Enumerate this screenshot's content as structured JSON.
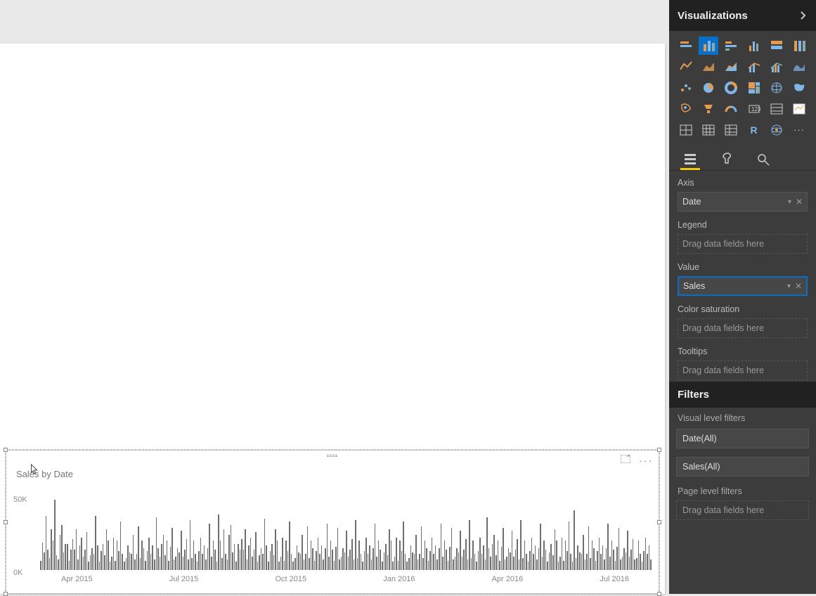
{
  "visualizations_pane": {
    "title": "Visualizations",
    "tabs": [
      "Fields",
      "Format",
      "Analytics"
    ],
    "icons": [
      "stacked-bar",
      "stacked-column",
      "clustered-bar",
      "clustered-column",
      "100-stacked-bar",
      "100-stacked-column",
      "line",
      "area",
      "stacked-area",
      "line-stacked-column",
      "line-clustered-column",
      "ribbon",
      "waterfall",
      "pie",
      "donut",
      "treemap",
      "map",
      "filled-map",
      "funnel",
      "gauge",
      "card",
      "multi-row-card",
      "kpi",
      "slicer",
      "matrix",
      "table",
      "table2",
      "r-script",
      "arcgis",
      "more"
    ],
    "selected_icon_index": 1,
    "wells": {
      "axis": {
        "label": "Axis",
        "value": "Date"
      },
      "legend": {
        "label": "Legend",
        "placeholder": "Drag data fields here"
      },
      "value": {
        "label": "Value",
        "value": "Sales"
      },
      "color_saturation": {
        "label": "Color saturation",
        "placeholder": "Drag data fields here"
      },
      "tooltips": {
        "label": "Tooltips",
        "placeholder": "Drag data fields here"
      }
    }
  },
  "filters_pane": {
    "title": "Filters",
    "visual_level_label": "Visual level filters",
    "visual_filters": [
      "Date(All)",
      "Sales(All)"
    ],
    "page_level_label": "Page level filters",
    "page_level_placeholder": "Drag data fields here"
  },
  "visual": {
    "title": "Sales by Date",
    "toolbar_icons": [
      "focus-mode-icon",
      "more-options-icon"
    ]
  },
  "chart_data": {
    "type": "bar",
    "title": "Sales by Date",
    "ylabel": "",
    "xlabel": "",
    "ylim": [
      0,
      55000
    ],
    "yticks": [
      "50K",
      "0K"
    ],
    "xticks": [
      "Apr 2015",
      "Jul 2015",
      "Oct 2015",
      "Jan 2016",
      "Apr 2016",
      "Jul 2016"
    ],
    "x_start": "2015-01",
    "x_end": "2016-07",
    "values": [
      7000,
      20000,
      13000,
      40000,
      15000,
      9000,
      30000,
      22000,
      52000,
      11000,
      8000,
      26000,
      33000,
      13000,
      19000,
      19000,
      7000,
      15000,
      23000,
      15000,
      30000,
      8000,
      18000,
      24000,
      10000,
      15000,
      28000,
      6000,
      11000,
      16000,
      12000,
      40000,
      18000,
      6000,
      14000,
      19000,
      11000,
      30000,
      22000,
      6000,
      10000,
      24000,
      7000,
      22000,
      14000,
      36000,
      12000,
      6000,
      9000,
      18000,
      13000,
      12000,
      26000,
      8000,
      12000,
      32000,
      9000,
      22000,
      16000,
      7000,
      14000,
      24000,
      12000,
      18000,
      8000,
      39000,
      16000,
      10000,
      19000,
      26000,
      11000,
      22000,
      7000,
      17000,
      31000,
      8000,
      10000,
      16000,
      13000,
      29000,
      10000,
      15000,
      23000,
      8000,
      37000,
      9000,
      22000,
      12000,
      6000,
      14000,
      24000,
      12000,
      18000,
      8000,
      16000,
      34000,
      10000,
      22000,
      15000,
      6000,
      41000,
      22000,
      9000,
      30000,
      12000,
      8000,
      26000,
      33000,
      13000,
      19000,
      6000,
      19000,
      15000,
      23000,
      15000,
      30000,
      8000,
      18000,
      24000,
      10000,
      15000,
      28000,
      6000,
      11000,
      16000,
      12000,
      38000,
      18000,
      6000,
      14000,
      19000,
      11000,
      30000,
      22000,
      6000,
      10000,
      24000,
      7000,
      22000,
      14000,
      36000,
      12000,
      6000,
      9000,
      18000,
      13000,
      12000,
      26000,
      8000,
      12000,
      32000,
      9000,
      22000,
      16000,
      7000,
      14000,
      24000,
      12000,
      18000,
      8000,
      16000,
      34000,
      10000,
      22000,
      15000,
      7000,
      17000,
      31000,
      8000,
      10000,
      16000,
      13000,
      29000,
      10000,
      15000,
      23000,
      8000,
      37000,
      9000,
      22000,
      12000,
      6000,
      14000,
      24000,
      12000,
      18000,
      8000,
      16000,
      34000,
      10000,
      22000,
      15000,
      6000,
      13000,
      19000,
      11000,
      30000,
      22000,
      6000,
      10000,
      24000,
      7000,
      22000,
      14000,
      36000,
      12000,
      6000,
      9000,
      18000,
      13000,
      12000,
      26000,
      8000,
      12000,
      32000,
      9000,
      22000,
      16000,
      7000,
      14000,
      24000,
      12000,
      18000,
      8000,
      16000,
      34000,
      10000,
      22000,
      15000,
      7000,
      17000,
      31000,
      8000,
      10000,
      16000,
      13000,
      29000,
      10000,
      15000,
      23000,
      8000,
      37000,
      9000,
      22000,
      12000,
      6000,
      14000,
      24000,
      12000,
      18000,
      8000,
      39000,
      16000,
      10000,
      19000,
      26000,
      11000,
      22000,
      7000,
      17000,
      31000,
      8000,
      10000,
      16000,
      13000,
      29000,
      10000,
      15000,
      23000,
      8000,
      37000,
      9000,
      22000,
      12000,
      6000,
      14000,
      24000,
      12000,
      18000,
      8000,
      16000,
      34000,
      10000,
      22000,
      15000,
      6000,
      13000,
      19000,
      11000,
      30000,
      22000,
      6000,
      10000,
      24000,
      7000,
      22000,
      14000,
      36000,
      12000,
      6000,
      44000,
      9000,
      18000,
      13000,
      12000,
      26000,
      8000,
      12000,
      32000,
      9000,
      22000,
      16000,
      7000,
      14000,
      24000,
      12000,
      18000,
      8000,
      16000,
      34000,
      10000,
      22000,
      15000,
      7000,
      17000,
      31000,
      8000,
      10000,
      16000,
      13000,
      29000,
      10000,
      15000,
      23000,
      8000,
      9000,
      22000,
      12000,
      6000,
      14000,
      24000,
      12000,
      18000,
      8000
    ]
  }
}
